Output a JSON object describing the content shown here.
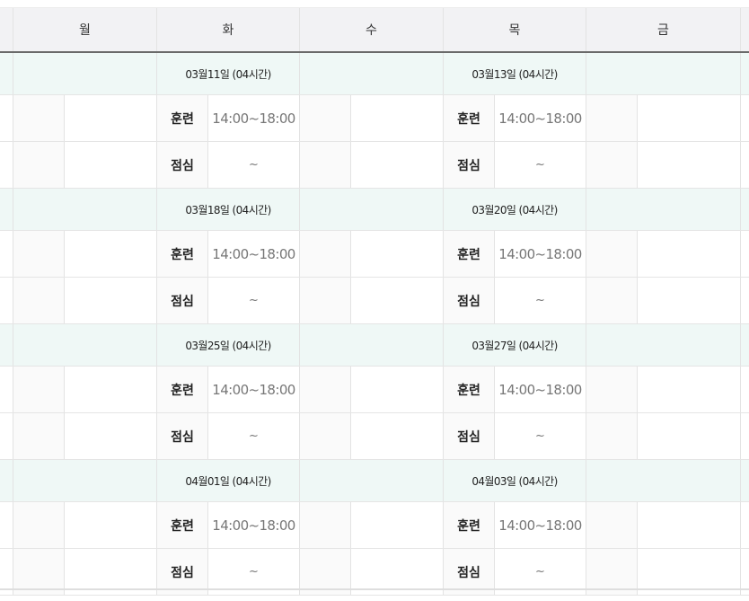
{
  "header": {
    "days": [
      "월",
      "화",
      "수",
      "목",
      "금"
    ]
  },
  "weeks": [
    {
      "tue_date": "03월11일 (04시간)",
      "thu_date": "03월13일 (04시간)",
      "train_label": "훈련",
      "train_time_tue": "14:00~18:00",
      "train_time_thu": "14:00~18:00",
      "lunch_label": "점심",
      "lunch_time_tue": "~",
      "lunch_time_thu": "~"
    },
    {
      "tue_date": "03월18일 (04시간)",
      "thu_date": "03월20일 (04시간)",
      "train_label": "훈련",
      "train_time_tue": "14:00~18:00",
      "train_time_thu": "14:00~18:00",
      "lunch_label": "점심",
      "lunch_time_tue": "~",
      "lunch_time_thu": "~"
    },
    {
      "tue_date": "03월25일 (04시간)",
      "thu_date": "03월27일 (04시간)",
      "train_label": "훈련",
      "train_time_tue": "14:00~18:00",
      "train_time_thu": "14:00~18:00",
      "lunch_label": "점심",
      "lunch_time_tue": "~",
      "lunch_time_thu": "~"
    },
    {
      "tue_date": "04월01일 (04시간)",
      "thu_date": "04월03일 (04시간)",
      "train_label": "훈련",
      "train_time_tue": "14:00~18:00",
      "train_time_thu": "14:00~18:00",
      "lunch_label": "점심",
      "lunch_time_tue": "~",
      "lunch_time_thu": "~"
    }
  ]
}
